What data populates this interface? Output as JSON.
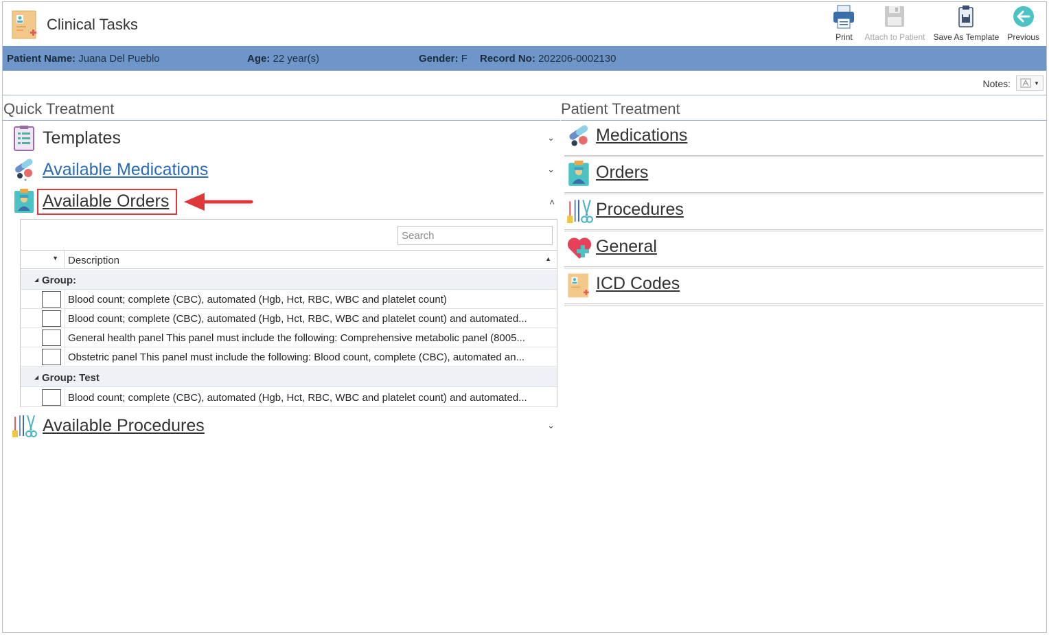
{
  "app": {
    "title": "Clinical Tasks"
  },
  "toolbar": {
    "print": "Print",
    "attach": "Attach to Patient",
    "save_template": "Save As Template",
    "previous": "Previous"
  },
  "patient": {
    "name_label": "Patient Name:",
    "name": "Juana Del Pueblo",
    "age_label": "Age:",
    "age": "22 year(s)",
    "gender_label": "Gender:",
    "gender": "F",
    "record_label": "Record No:",
    "record": "202206-0002130"
  },
  "notes": {
    "label": "Notes:"
  },
  "quick_treatment": {
    "title": "Quick Treatment",
    "templates": "Templates",
    "available_medications": "Available Medications",
    "available_orders": "Available Orders",
    "available_procedures": "Available Procedures"
  },
  "orders_grid": {
    "search_placeholder": "Search",
    "column_description": "Description",
    "groups": [
      {
        "label": "Group:",
        "rows": [
          "Blood count; complete (CBC), automated (Hgb, Hct, RBC, WBC and platelet count)",
          "Blood count; complete (CBC), automated (Hgb, Hct, RBC, WBC and platelet count) and automated...",
          "General health panel This panel must include the following: Comprehensive metabolic panel (8005...",
          "Obstetric panel This panel must include the following: Blood count, complete (CBC), automated an..."
        ]
      },
      {
        "label": "Group: Test",
        "rows": [
          "Blood count; complete (CBC), automated (Hgb, Hct, RBC, WBC and platelet count) and automated..."
        ]
      }
    ]
  },
  "patient_treatment": {
    "title": "Patient Treatment",
    "medications": "Medications",
    "orders": "Orders",
    "procedures": "Procedures",
    "general": "General",
    "icd_codes": "ICD Codes"
  }
}
